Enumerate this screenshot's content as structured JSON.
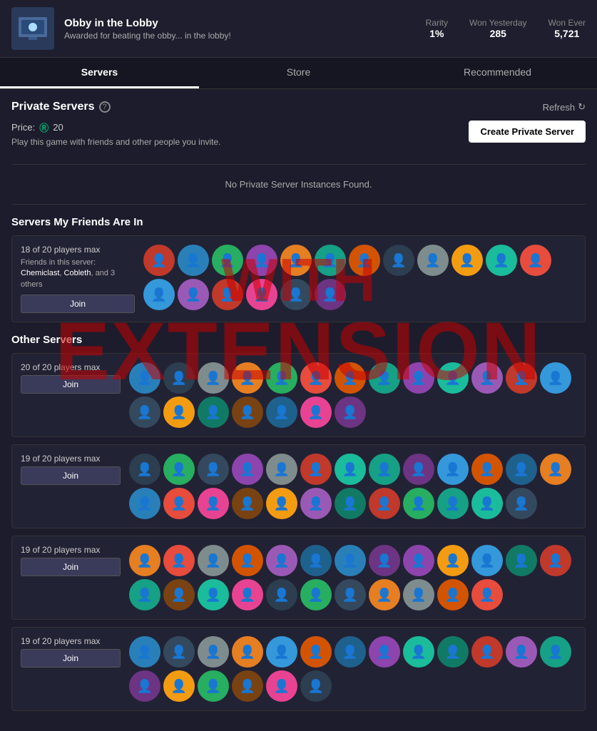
{
  "topBadge": {
    "title": "Obby in the Lobby",
    "description": "Awarded for beating the obby... in the lobby!",
    "stats": {
      "rarity_label": "Rarity",
      "rarity_value": "1%",
      "won_yesterday_label": "Won Yesterday",
      "won_yesterday_value": "285",
      "won_ever_label": "Won Ever",
      "won_ever_value": "5,721"
    }
  },
  "tabs": [
    {
      "id": "servers",
      "label": "Servers",
      "active": true
    },
    {
      "id": "store",
      "label": "Store",
      "active": false
    },
    {
      "id": "recommended",
      "label": "Recommended",
      "active": false
    }
  ],
  "privateServers": {
    "title": "Private Servers",
    "refresh_label": "Refresh",
    "price_label": "Price:",
    "price_value": "20",
    "play_text": "Play this game with friends and other people you invite.",
    "create_button": "Create Private Server",
    "no_instances": "No Private Server Instances Found."
  },
  "friendsSection": {
    "title": "Servers My Friends Are In",
    "server": {
      "player_count": "18 of 20 players max",
      "friends_text": "Friends in this server: Chemiclast, Cobleth, and 3 others",
      "join_label": "Join"
    }
  },
  "otherServers": {
    "title": "Other Servers",
    "servers": [
      {
        "player_count": "20 of 20 players max",
        "join_label": "Join"
      },
      {
        "player_count": "19 of 20 players max",
        "join_label": "Join"
      },
      {
        "player_count": "19 of 20 players max",
        "join_label": "Join"
      },
      {
        "player_count": "19 of 20 players max",
        "join_label": "Join"
      }
    ]
  },
  "watermark": {
    "line1": "WITH",
    "line2": "EXTENSION"
  }
}
